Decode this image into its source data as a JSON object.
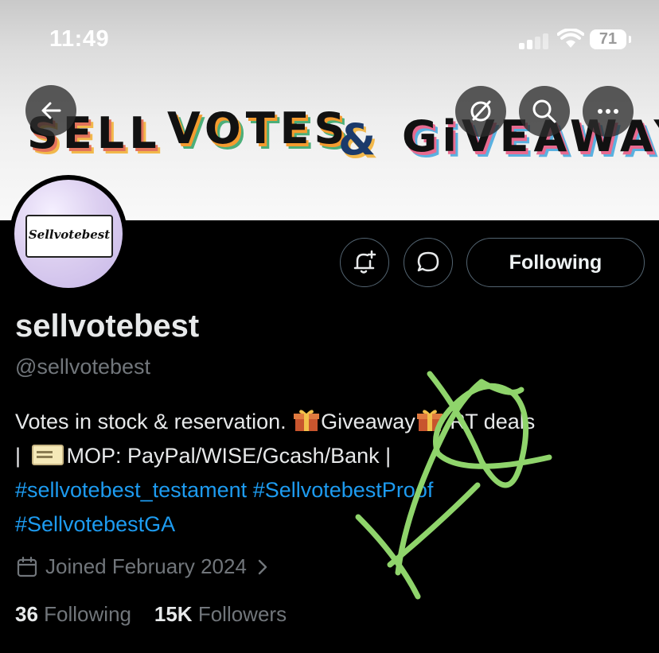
{
  "status_bar": {
    "time": "11:49",
    "battery": "71"
  },
  "banner": {
    "words": [
      "SELL",
      "VOTES",
      "&",
      "GiVEAWAY"
    ]
  },
  "nav": {
    "back_icon": "arrow-left-icon",
    "icons": [
      "grok-icon",
      "search-icon",
      "more-icon"
    ]
  },
  "profile": {
    "avatar_text": "Sellvotebest",
    "display_name": "sellvotebest",
    "handle": "@sellvotebest",
    "bio": {
      "line1_a": "Votes in stock & reservation. ",
      "line1_b": "Giveaway",
      "line1_c": " RT deals",
      "line2_a": "| ",
      "line2_b": "MOP: PayPal/WISE/Gcash/Bank |",
      "hashtag1": "#sellvotebest_testament",
      "hashtag2": "#SellvotebestProof",
      "hashtag3": "#SellvotebestGA"
    },
    "joined": "Joined February 2024",
    "following_count": "36",
    "following_label": "Following",
    "followers_count": "15K",
    "followers_label": "Followers"
  },
  "actions": {
    "following_button": "Following"
  },
  "colors": {
    "link": "#1d9bf0",
    "scribble": "#8fd46b",
    "muted": "#71767b"
  }
}
